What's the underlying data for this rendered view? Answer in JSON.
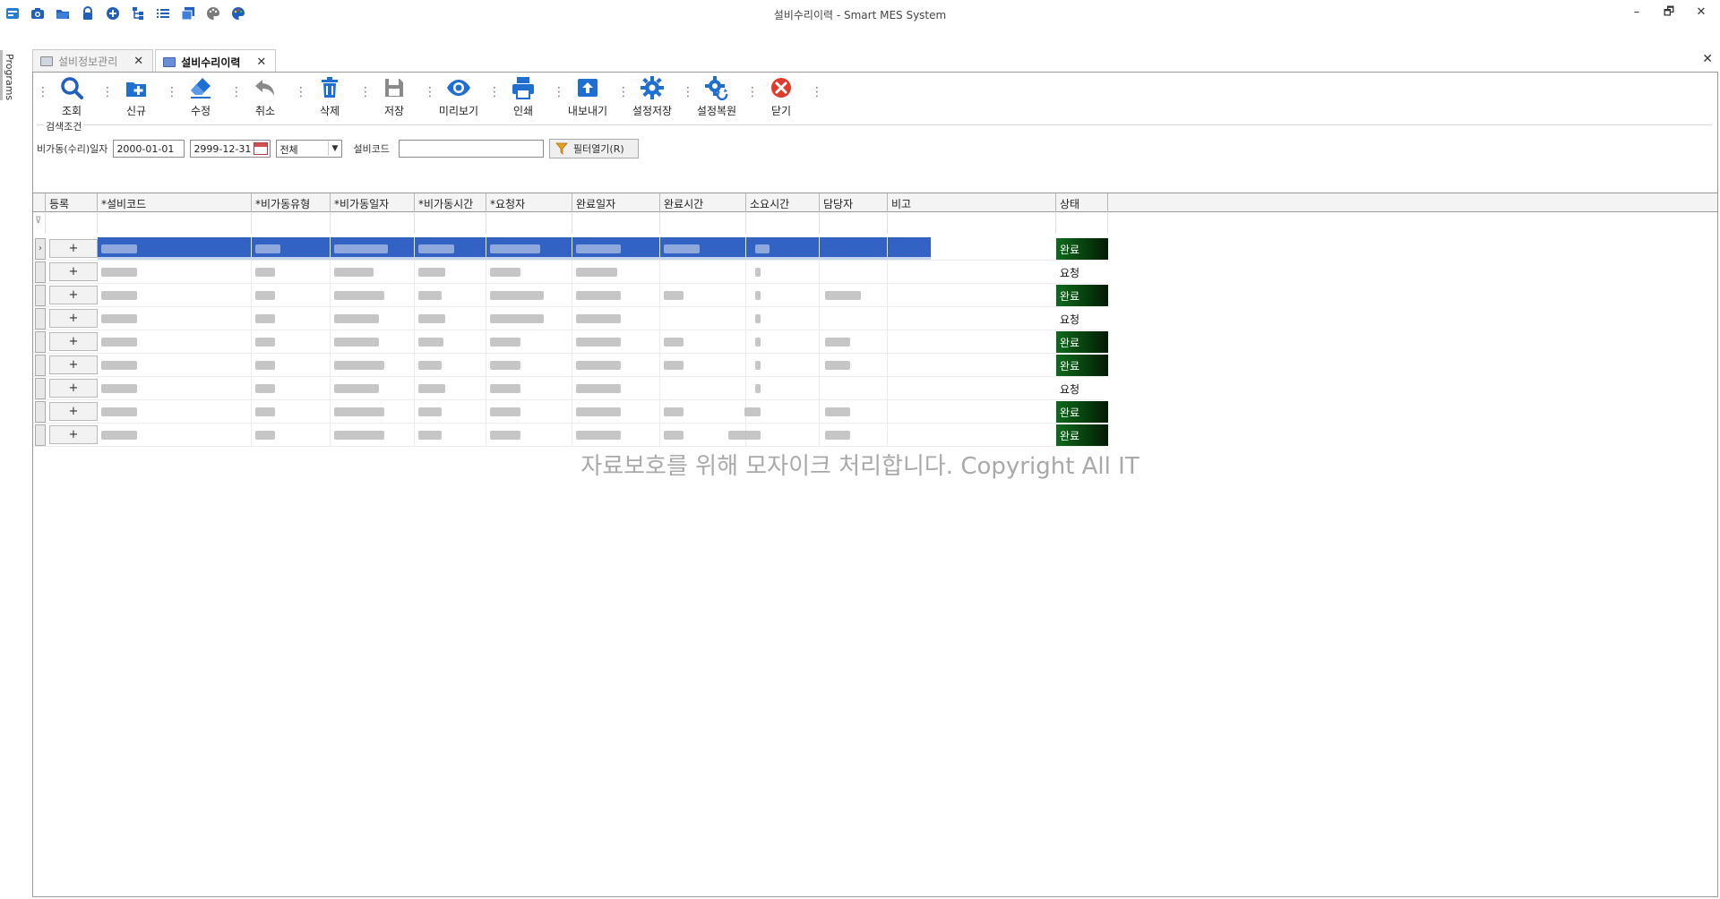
{
  "window": {
    "title": "설비수리이력 - Smart MES System",
    "quick_icons": [
      "app-icon",
      "camera-icon",
      "folder-icon",
      "lock-icon",
      "medical-plus-icon",
      "org-chart-icon",
      "list-icon",
      "window-icon",
      "palette-icon",
      "palette-color-icon"
    ],
    "controls": {
      "minimize": "–",
      "restore": "🗗",
      "close": "✕"
    }
  },
  "side_panel": {
    "label": "Programs"
  },
  "tabs": [
    {
      "label": "설비정보관리",
      "active": false,
      "close": "✕"
    },
    {
      "label": "설비수리이력",
      "active": true,
      "close": "✕"
    }
  ],
  "close_all": "✕",
  "toolbar": [
    {
      "label": "조회",
      "icon": "search-icon",
      "color": "#1f5fbf"
    },
    {
      "label": "신규",
      "icon": "new-icon",
      "color": "#1f6fd1"
    },
    {
      "label": "수정",
      "icon": "eraser-icon",
      "color": "#1f6fd1"
    },
    {
      "label": "취소",
      "icon": "undo-icon",
      "color": "#8a8a8a"
    },
    {
      "label": "삭제",
      "icon": "trash-icon",
      "color": "#1f6fd1"
    },
    {
      "label": "저장",
      "icon": "save-icon",
      "color": "#8a8a8a"
    },
    {
      "label": "미리보기",
      "icon": "eye-icon",
      "color": "#1f6fd1"
    },
    {
      "label": "인쇄",
      "icon": "print-icon",
      "color": "#1f6fd1"
    },
    {
      "label": "내보내기",
      "icon": "export-icon",
      "color": "#1f6fd1"
    },
    {
      "label": "설정저장",
      "icon": "gear-icon",
      "color": "#1f6fd1"
    },
    {
      "label": "설정복원",
      "icon": "gear-restore-icon",
      "color": "#1f6fd1"
    },
    {
      "label": "닫기",
      "icon": "close-circle-icon",
      "color": "#e03a2a"
    }
  ],
  "search": {
    "group_label": "검색조건",
    "date_label": "비가동(수리)일자",
    "date_from": "2000-01-01",
    "date_to": "2999-12-31",
    "type_select": "전체",
    "code_label": "설비코드",
    "code_value": "",
    "filter_button": "필터열기(R)"
  },
  "grid": {
    "columns": [
      "등록",
      "*설비코드",
      "*비가동유형",
      "*비가동일자",
      "*비가동시간",
      "*요청자",
      "완료일자",
      "완료시간",
      "소요시간",
      "담당자",
      "비고",
      "상태"
    ],
    "row_button": "+",
    "selected_row": 0,
    "rows": [
      {
        "status": "완료"
      },
      {
        "status": "요청"
      },
      {
        "status": "완료"
      },
      {
        "status": "요청"
      },
      {
        "status": "완료"
      },
      {
        "status": "완료"
      },
      {
        "status": "요청"
      },
      {
        "status": "완료"
      },
      {
        "status": "완료"
      }
    ]
  },
  "status_colors": {
    "완료": "#0f6a1c",
    "요청": "#ffffff"
  },
  "watermark": "자료보호를 위해 모자이크 처리합니다. Copyright All IT"
}
